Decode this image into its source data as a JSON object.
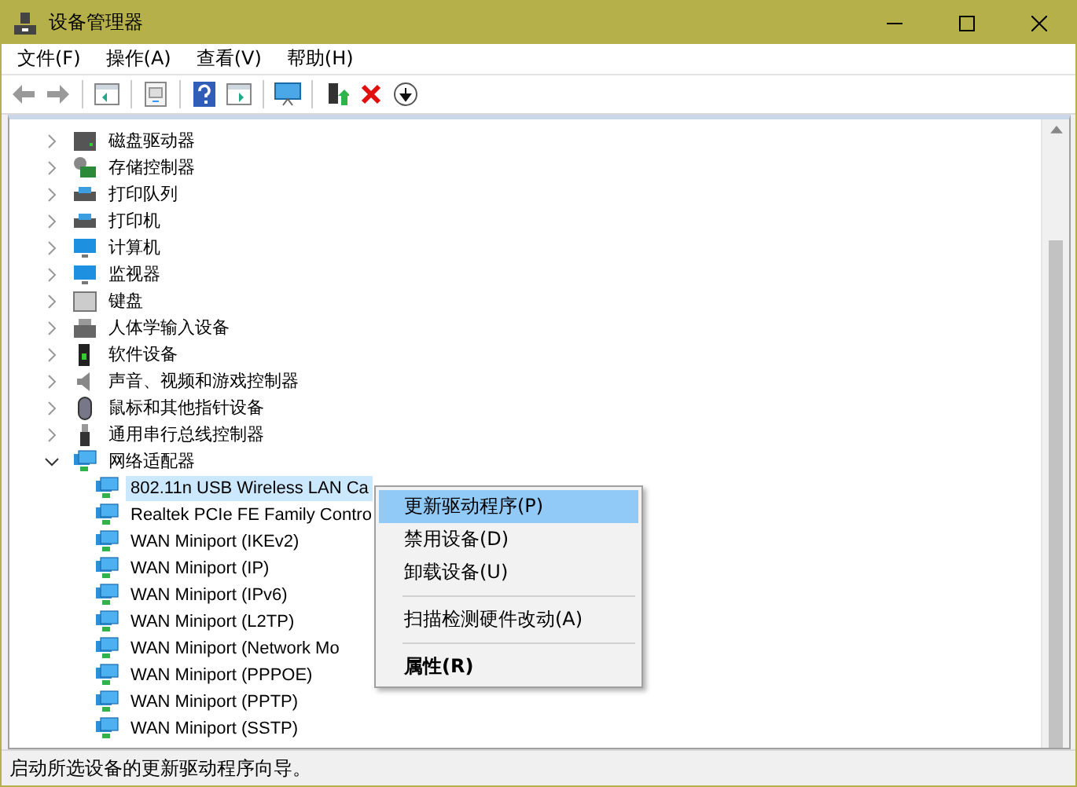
{
  "window": {
    "title": "设备管理器"
  },
  "menu": [
    "文件(F)",
    "操作(A)",
    "查看(V)",
    "帮助(H)"
  ],
  "tree": [
    {
      "label": "磁盘驱动器",
      "expanded": false
    },
    {
      "label": "存储控制器",
      "expanded": false
    },
    {
      "label": "打印队列",
      "expanded": false
    },
    {
      "label": "打印机",
      "expanded": false
    },
    {
      "label": "计算机",
      "expanded": false
    },
    {
      "label": "监视器",
      "expanded": false
    },
    {
      "label": "键盘",
      "expanded": false
    },
    {
      "label": "人体学输入设备",
      "expanded": false
    },
    {
      "label": "软件设备",
      "expanded": false
    },
    {
      "label": "声音、视频和游戏控制器",
      "expanded": false
    },
    {
      "label": "鼠标和其他指针设备",
      "expanded": false
    },
    {
      "label": "通用串行总线控制器",
      "expanded": false
    },
    {
      "label": "网络适配器",
      "expanded": true,
      "children": [
        {
          "label": "802.11n USB Wireless LAN Ca",
          "selected": true
        },
        {
          "label": "Realtek PCIe FE Family Contro",
          "selected": false
        },
        {
          "label": "WAN Miniport (IKEv2)",
          "selected": false
        },
        {
          "label": "WAN Miniport (IP)",
          "selected": false
        },
        {
          "label": "WAN Miniport (IPv6)",
          "selected": false
        },
        {
          "label": "WAN Miniport (L2TP)",
          "selected": false
        },
        {
          "label": "WAN Miniport (Network Mo",
          "selected": false
        },
        {
          "label": "WAN Miniport (PPPOE)",
          "selected": false
        },
        {
          "label": "WAN Miniport (PPTP)",
          "selected": false
        },
        {
          "label": "WAN Miniport (SSTP)",
          "selected": false
        }
      ]
    }
  ],
  "context_menu": [
    {
      "kind": "item",
      "label": "更新驱动程序(P)",
      "selected": true
    },
    {
      "kind": "item",
      "label": "禁用设备(D)",
      "selected": false
    },
    {
      "kind": "item",
      "label": "卸载设备(U)",
      "selected": false
    },
    {
      "kind": "separator"
    },
    {
      "kind": "item",
      "label": "扫描检测硬件改动(A)",
      "selected": false
    },
    {
      "kind": "separator"
    },
    {
      "kind": "default",
      "label": "属性(R)",
      "selected": false
    }
  ],
  "status_bar": {
    "text": "启动所选设备的更新驱动程序向导。"
  }
}
